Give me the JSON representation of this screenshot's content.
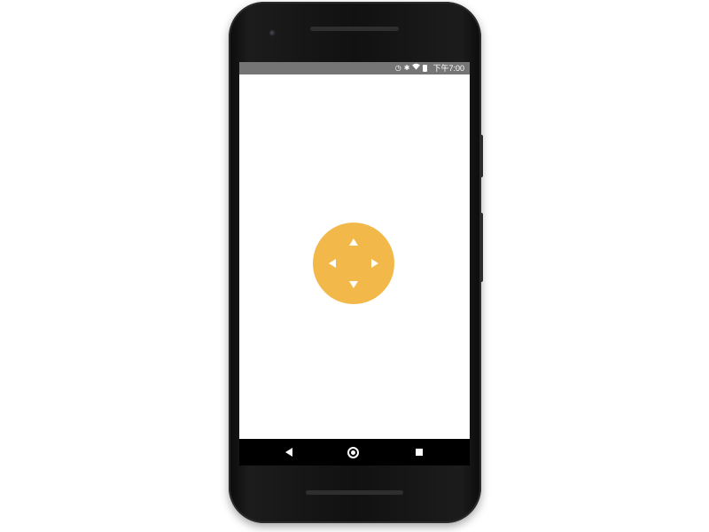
{
  "status_bar": {
    "icons": [
      "alarm-icon",
      "bluetooth-icon",
      "wifi-icon",
      "battery-icon"
    ],
    "time": "下午7:00",
    "background_color": "#757575"
  },
  "dpad": {
    "color": "#F2B84A",
    "arrows": [
      "up",
      "down",
      "left",
      "right"
    ]
  },
  "nav_bar": {
    "buttons": [
      "back-icon",
      "home-icon",
      "recents-icon"
    ]
  }
}
